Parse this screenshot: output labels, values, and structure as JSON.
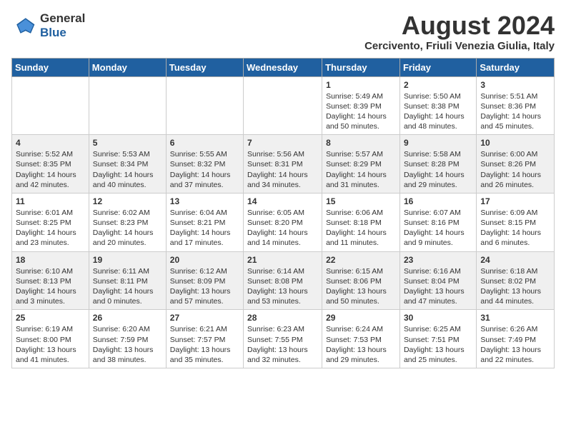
{
  "logo": {
    "line1": "General",
    "line2": "Blue"
  },
  "title": "August 2024",
  "location": "Cercivento, Friuli Venezia Giulia, Italy",
  "headers": [
    "Sunday",
    "Monday",
    "Tuesday",
    "Wednesday",
    "Thursday",
    "Friday",
    "Saturday"
  ],
  "weeks": [
    [
      {
        "day": "",
        "info": ""
      },
      {
        "day": "",
        "info": ""
      },
      {
        "day": "",
        "info": ""
      },
      {
        "day": "",
        "info": ""
      },
      {
        "day": "1",
        "info": "Sunrise: 5:49 AM\nSunset: 8:39 PM\nDaylight: 14 hours\nand 50 minutes."
      },
      {
        "day": "2",
        "info": "Sunrise: 5:50 AM\nSunset: 8:38 PM\nDaylight: 14 hours\nand 48 minutes."
      },
      {
        "day": "3",
        "info": "Sunrise: 5:51 AM\nSunset: 8:36 PM\nDaylight: 14 hours\nand 45 minutes."
      }
    ],
    [
      {
        "day": "4",
        "info": "Sunrise: 5:52 AM\nSunset: 8:35 PM\nDaylight: 14 hours\nand 42 minutes."
      },
      {
        "day": "5",
        "info": "Sunrise: 5:53 AM\nSunset: 8:34 PM\nDaylight: 14 hours\nand 40 minutes."
      },
      {
        "day": "6",
        "info": "Sunrise: 5:55 AM\nSunset: 8:32 PM\nDaylight: 14 hours\nand 37 minutes."
      },
      {
        "day": "7",
        "info": "Sunrise: 5:56 AM\nSunset: 8:31 PM\nDaylight: 14 hours\nand 34 minutes."
      },
      {
        "day": "8",
        "info": "Sunrise: 5:57 AM\nSunset: 8:29 PM\nDaylight: 14 hours\nand 31 minutes."
      },
      {
        "day": "9",
        "info": "Sunrise: 5:58 AM\nSunset: 8:28 PM\nDaylight: 14 hours\nand 29 minutes."
      },
      {
        "day": "10",
        "info": "Sunrise: 6:00 AM\nSunset: 8:26 PM\nDaylight: 14 hours\nand 26 minutes."
      }
    ],
    [
      {
        "day": "11",
        "info": "Sunrise: 6:01 AM\nSunset: 8:25 PM\nDaylight: 14 hours\nand 23 minutes."
      },
      {
        "day": "12",
        "info": "Sunrise: 6:02 AM\nSunset: 8:23 PM\nDaylight: 14 hours\nand 20 minutes."
      },
      {
        "day": "13",
        "info": "Sunrise: 6:04 AM\nSunset: 8:21 PM\nDaylight: 14 hours\nand 17 minutes."
      },
      {
        "day": "14",
        "info": "Sunrise: 6:05 AM\nSunset: 8:20 PM\nDaylight: 14 hours\nand 14 minutes."
      },
      {
        "day": "15",
        "info": "Sunrise: 6:06 AM\nSunset: 8:18 PM\nDaylight: 14 hours\nand 11 minutes."
      },
      {
        "day": "16",
        "info": "Sunrise: 6:07 AM\nSunset: 8:16 PM\nDaylight: 14 hours\nand 9 minutes."
      },
      {
        "day": "17",
        "info": "Sunrise: 6:09 AM\nSunset: 8:15 PM\nDaylight: 14 hours\nand 6 minutes."
      }
    ],
    [
      {
        "day": "18",
        "info": "Sunrise: 6:10 AM\nSunset: 8:13 PM\nDaylight: 14 hours\nand 3 minutes."
      },
      {
        "day": "19",
        "info": "Sunrise: 6:11 AM\nSunset: 8:11 PM\nDaylight: 14 hours\nand 0 minutes."
      },
      {
        "day": "20",
        "info": "Sunrise: 6:12 AM\nSunset: 8:09 PM\nDaylight: 13 hours\nand 57 minutes."
      },
      {
        "day": "21",
        "info": "Sunrise: 6:14 AM\nSunset: 8:08 PM\nDaylight: 13 hours\nand 53 minutes."
      },
      {
        "day": "22",
        "info": "Sunrise: 6:15 AM\nSunset: 8:06 PM\nDaylight: 13 hours\nand 50 minutes."
      },
      {
        "day": "23",
        "info": "Sunrise: 6:16 AM\nSunset: 8:04 PM\nDaylight: 13 hours\nand 47 minutes."
      },
      {
        "day": "24",
        "info": "Sunrise: 6:18 AM\nSunset: 8:02 PM\nDaylight: 13 hours\nand 44 minutes."
      }
    ],
    [
      {
        "day": "25",
        "info": "Sunrise: 6:19 AM\nSunset: 8:00 PM\nDaylight: 13 hours\nand 41 minutes."
      },
      {
        "day": "26",
        "info": "Sunrise: 6:20 AM\nSunset: 7:59 PM\nDaylight: 13 hours\nand 38 minutes."
      },
      {
        "day": "27",
        "info": "Sunrise: 6:21 AM\nSunset: 7:57 PM\nDaylight: 13 hours\nand 35 minutes."
      },
      {
        "day": "28",
        "info": "Sunrise: 6:23 AM\nSunset: 7:55 PM\nDaylight: 13 hours\nand 32 minutes."
      },
      {
        "day": "29",
        "info": "Sunrise: 6:24 AM\nSunset: 7:53 PM\nDaylight: 13 hours\nand 29 minutes."
      },
      {
        "day": "30",
        "info": "Sunrise: 6:25 AM\nSunset: 7:51 PM\nDaylight: 13 hours\nand 25 minutes."
      },
      {
        "day": "31",
        "info": "Sunrise: 6:26 AM\nSunset: 7:49 PM\nDaylight: 13 hours\nand 22 minutes."
      }
    ]
  ]
}
